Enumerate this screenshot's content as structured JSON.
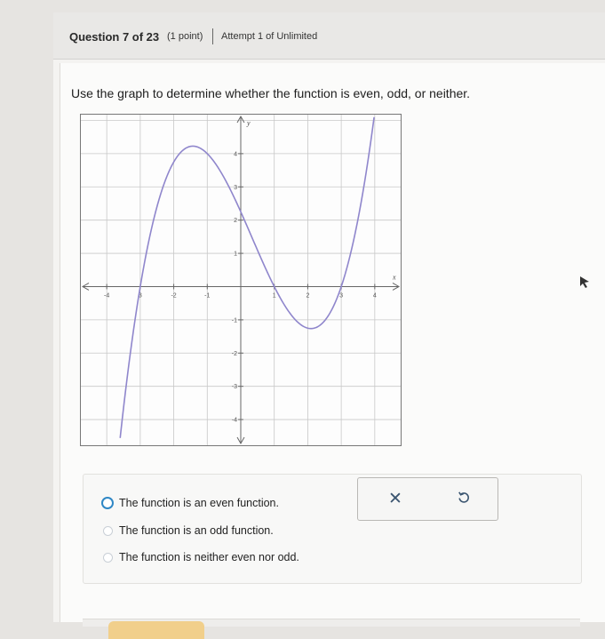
{
  "header": {
    "question": "Question 7 of 23",
    "points": "(1 point)",
    "attempt": "Attempt 1 of Unlimited"
  },
  "prompt": "Use the graph to determine whether the function is even, odd, or neither.",
  "graph": {
    "axis_x_label": "x",
    "axis_y_label": "y",
    "x_ticks": [
      "-4",
      "3",
      "-2",
      "-1",
      "1",
      "2",
      "3",
      "4"
    ],
    "y_ticks": [
      "4",
      "3",
      "2",
      "1",
      "-1",
      "-2",
      "-3",
      "-4"
    ],
    "x_range": [
      -4.8,
      4.8
    ],
    "y_range": [
      -4.8,
      5.2
    ],
    "curve_color": "#8f86cc",
    "function_description": "cubic with roots at -3, 1, 3"
  },
  "options": [
    {
      "label": "The function is an even function."
    },
    {
      "label": "The function is an odd function."
    },
    {
      "label": "The function is neither even nor odd."
    }
  ],
  "tools": {
    "clear_icon": "x-icon",
    "undo_icon": "undo-icon"
  },
  "colors": {
    "accent": "#2f87c5",
    "button": "#f1cf8b"
  }
}
